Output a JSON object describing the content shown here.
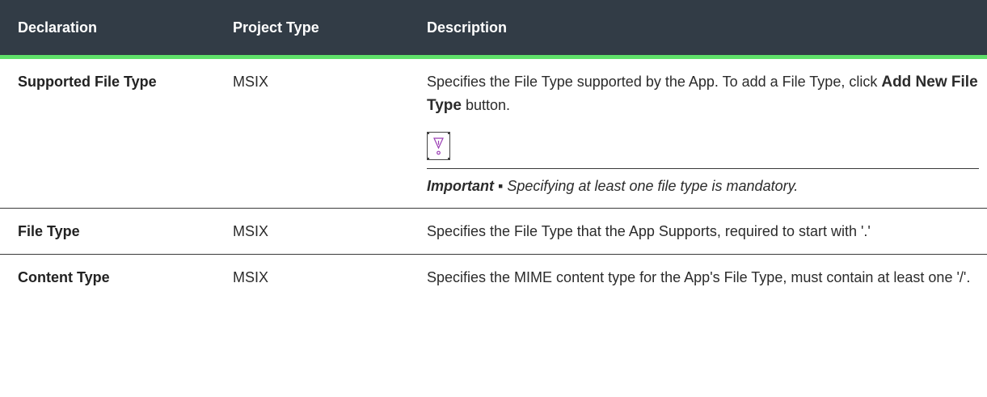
{
  "table": {
    "headers": [
      "Declaration",
      "Project Type",
      "Description"
    ],
    "rows": [
      {
        "declaration": "Supported File Type",
        "project_type": "MSIX",
        "description_before": "Specifies the File Type supported by the App. To add a File Type, click ",
        "description_bold": "Add New File Type",
        "description_after": " button.",
        "note": {
          "icon": "important-icon",
          "lead": "Important ▪",
          "text": " Specifying at least one file type is mandatory."
        }
      },
      {
        "declaration": "File Type",
        "project_type": "MSIX",
        "description": "Specifies the File Type that the App Supports, required to start with '.'"
      },
      {
        "declaration": "Content Type",
        "project_type": "MSIX",
        "description": "Specifies the MIME content type for the App's File Type, must contain at least one '/'."
      }
    ]
  },
  "colors": {
    "header_bg": "#323c46",
    "header_text": "#ffffff",
    "header_accent": "#5fe06a",
    "icon_accent": "#9b3fb5"
  }
}
